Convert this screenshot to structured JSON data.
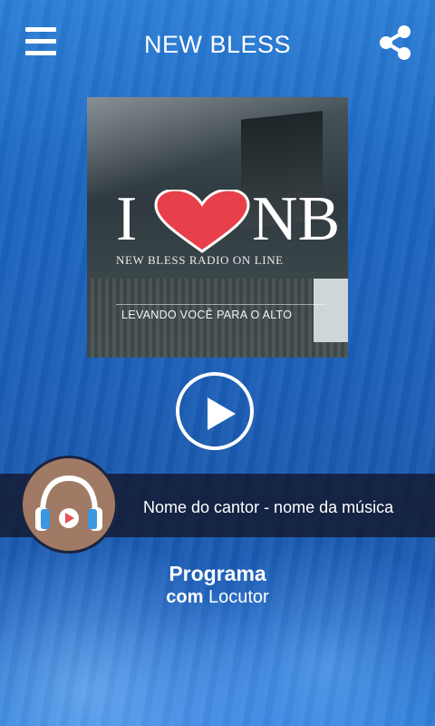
{
  "header": {
    "title": "NEW BLESS",
    "menu_icon": "hamburger-menu-icon",
    "share_icon": "share-icon"
  },
  "cover": {
    "logo_left": "I",
    "logo_right": "NB",
    "heart_icon": "heart-icon",
    "subtitle": "NEW BLESS  RADIO ON LINE",
    "tagline": "LEVANDO VOCÊ PARA O ALTO"
  },
  "player": {
    "play_icon": "play-icon",
    "now_playing": "Nome do cantor - nome da música",
    "avatar_icon": "headphones-icon"
  },
  "program": {
    "title": "Programa",
    "prefix": "com",
    "host": "Locutor"
  },
  "colors": {
    "accent": "#ffffff",
    "bar": "#14192d",
    "heart": "#e8404a",
    "avatar_bg": "#a07a64"
  }
}
